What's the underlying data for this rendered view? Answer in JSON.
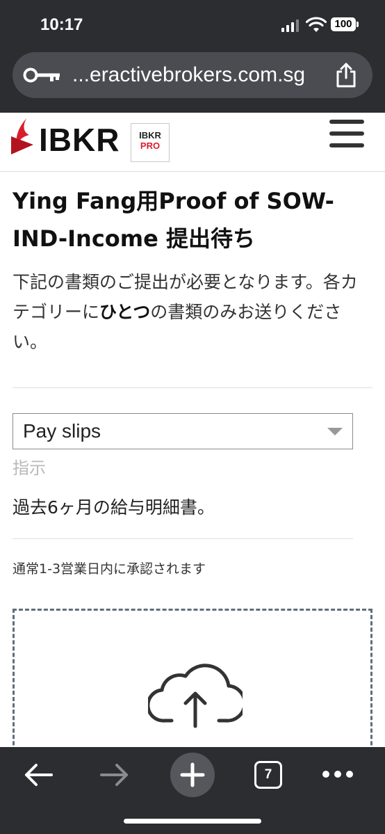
{
  "status_bar": {
    "time": "10:17",
    "battery": "100"
  },
  "browser": {
    "url": "...eractivebrokers.com.sg",
    "tab_count": "7"
  },
  "header": {
    "logo_text": "IBKR",
    "badge_line1": "IBKR",
    "badge_line2": "PRO",
    "brand_color": "#d81e2c"
  },
  "main": {
    "title": "Ying Fang用Proof of SOW-IND-Income 提出待ち",
    "desc_part1": "下記の書類のご提出が必要となります。各カテゴリーに",
    "desc_bold": "ひとつ",
    "desc_part2": "の書類のみお送りください。",
    "document_type": {
      "selected": "Pay slips"
    },
    "instructions_label": "指示",
    "instructions_text": "過去6ヶ月の給与明細書。",
    "approval_note": "通常1-3営業日内に承認されます"
  },
  "icons": {
    "url_left": "key-icon",
    "url_right": "share-icon",
    "upload": "cloud-upload-icon",
    "menu": "hamburger-menu-icon",
    "toolbar": [
      "back-arrow-icon",
      "forward-arrow-icon",
      "plus-icon",
      "tabs-icon",
      "more-icon"
    ]
  }
}
